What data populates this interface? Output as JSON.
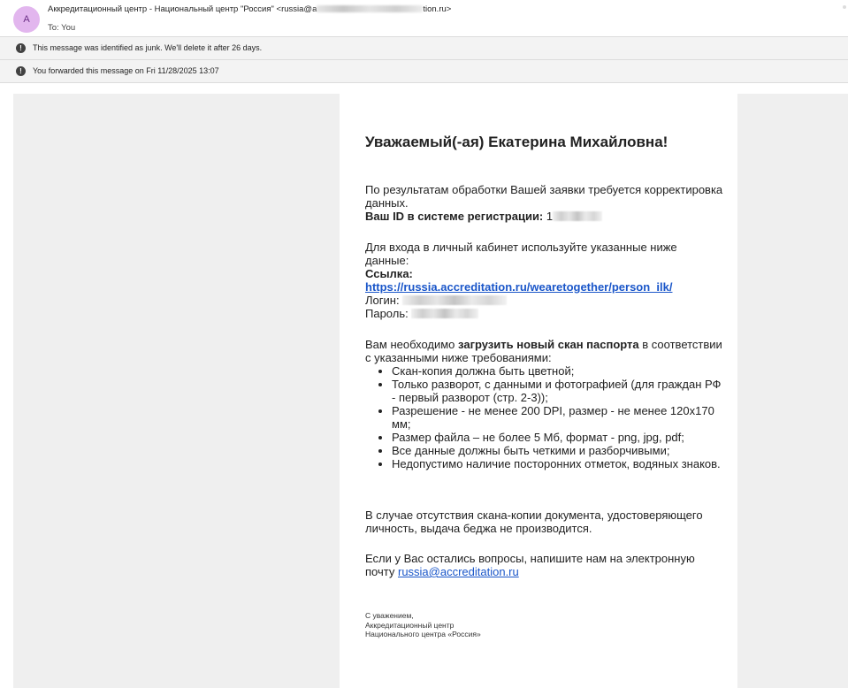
{
  "header": {
    "avatar_letter": "A",
    "sender": "Аккредитационный центр - Национальный центр \"Россия\"",
    "sender_email_tail": "<russia@a",
    "sender_email_end": "tion.ru>",
    "to": "To: You"
  },
  "notices": {
    "junk": "This message was identified as junk. We'll delete it after 26 days.",
    "forwarded": "You forwarded this message on Fri 11/28/2025 13:07"
  },
  "email": {
    "greeting": "Уважаемый(-ая) Екатерина Михайловна!",
    "p1_line": "По результатам обработки Вашей заявки требуется корректировка данных.",
    "id_label": "Ваш ID в системе регистрации:",
    "id_value_start": "1",
    "login_intro": "Для входа в личный кабинет используйте указанные ниже данные:",
    "link_label": "Ссылка:",
    "link_url": "https://russia.accreditation.ru/wearetogether/person_ilk/",
    "login_label": "Логин:",
    "password_label": "Пароль:",
    "upload_prefix": "Вам необходимо",
    "upload_bold": "загрузить новый скан паспорта",
    "upload_suffix": "в соответствии с указанными ниже требованиями:",
    "requirements": [
      "Скан-копия должна быть цветной;",
      "Только разворот, с данными и фотографией (для граждан РФ - первый разворот (стр. 2-3));",
      "Разрешение - не менее 200 DPI, размер - не менее 120х170 мм;",
      "Размер файла – не более 5 Мб, формат - png, jpg, pdf;",
      "Все данные должны быть четкими и разборчивыми;",
      "Недопустимо наличие посторонних отметок, водяных знаков."
    ],
    "absence_note": "В случае отсутствия скана-копии документа, удостоверяющего личность, выдача беджа не производится.",
    "questions": "Если у Вас остались вопросы, напишите нам на электронную почту",
    "contact_email": "russia@accreditation.ru",
    "signature": {
      "line1": "С уважением,",
      "line2": "Аккредитационный центр",
      "line3": "Национального центра «Россия»"
    }
  }
}
